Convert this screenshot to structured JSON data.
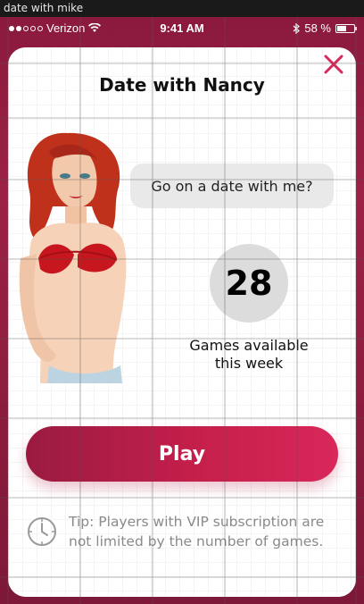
{
  "window": {
    "title": "date with mike"
  },
  "status_bar": {
    "carrier": "Verizon",
    "time": "9:41 AM",
    "battery_percent": "58 %",
    "battery_level": 0.58
  },
  "card": {
    "title": "Date with Nancy",
    "speech": "Go on a date with me?",
    "games_count": "28",
    "games_label_line1": "Games available",
    "games_label_line2": "this week",
    "play_label": "Play",
    "tip": "Tip: Players with VIP subscription are not limited by the number of games."
  },
  "icons": {
    "close": "close-icon",
    "clock": "clock-icon",
    "wifi": "wifi-icon",
    "bluetooth": "bluetooth-icon",
    "battery": "battery-icon"
  },
  "colors": {
    "accent": "#c51f4b",
    "close": "#d72a5a",
    "background": "#8b1a3e"
  }
}
